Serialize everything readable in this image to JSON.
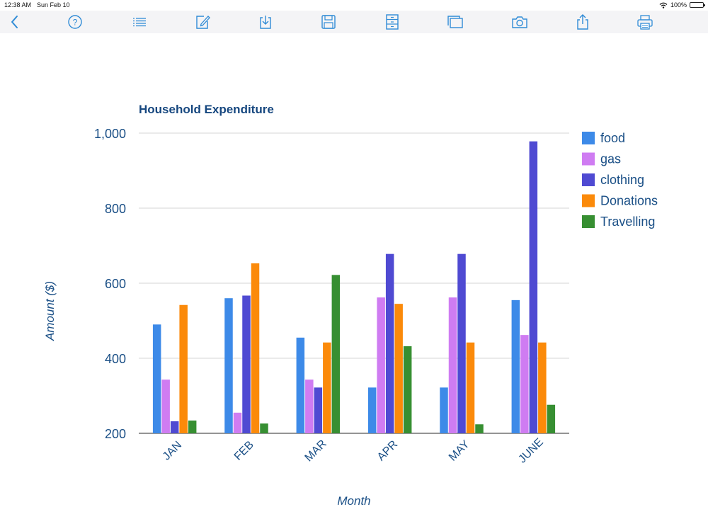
{
  "status": {
    "time": "12:38 AM",
    "date": "Sun Feb 10",
    "battery": "100%"
  },
  "toolbar": {
    "icons": [
      "back-icon",
      "help-icon",
      "list-icon",
      "edit-icon",
      "download-icon",
      "save-icon",
      "cabinet-icon",
      "windows-icon",
      "camera-icon",
      "share-icon",
      "print-icon"
    ],
    "color": "#2f8bd6"
  },
  "chart_data": {
    "type": "bar",
    "title": "Household Expenditure",
    "xlabel": "Month",
    "ylabel": "Amount ($)",
    "categories": [
      "JAN",
      "FEB",
      "MAR",
      "APR",
      "MAY",
      "JUNE"
    ],
    "ylim": [
      200,
      1000
    ],
    "yticks": [
      "200",
      "400",
      "600",
      "800",
      "1,000"
    ],
    "ytick_values": [
      200,
      400,
      600,
      800,
      1000
    ],
    "grid": true,
    "legend_position": "right",
    "series": [
      {
        "name": "food",
        "color": "#3d8ae8",
        "values": [
          490,
          560,
          455,
          322,
          322,
          555
        ]
      },
      {
        "name": "gas",
        "color": "#cf7cf2",
        "values": [
          343,
          255,
          343,
          562,
          562,
          462
        ]
      },
      {
        "name": "clothing",
        "color": "#4f4ad2",
        "values": [
          232,
          567,
          322,
          678,
          678,
          978
        ]
      },
      {
        "name": "Donations",
        "color": "#fb8a0a",
        "values": [
          542,
          653,
          442,
          545,
          442,
          442
        ]
      },
      {
        "name": "Travelling",
        "color": "#378f32",
        "values": [
          234,
          226,
          622,
          432,
          224,
          276
        ]
      }
    ]
  }
}
